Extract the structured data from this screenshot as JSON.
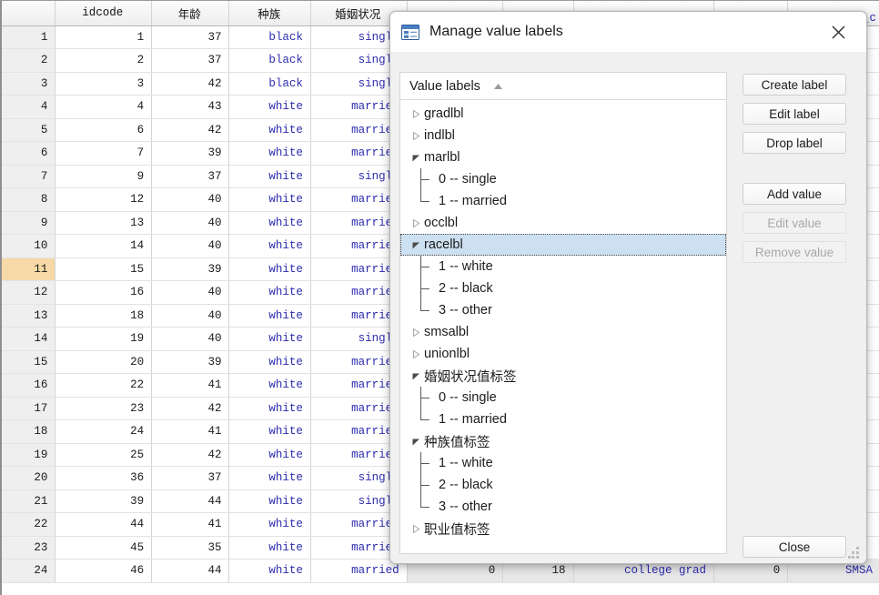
{
  "grid": {
    "columns": [
      {
        "key": "rownum",
        "label": "",
        "cjk": false
      },
      {
        "key": "idcode",
        "label": "idcode",
        "cjk": false
      },
      {
        "key": "age",
        "label": "年龄",
        "cjk": true
      },
      {
        "key": "race",
        "label": "种族",
        "cjk": true
      },
      {
        "key": "marital",
        "label": "婚姻状况",
        "cjk": true
      }
    ],
    "partial_header_right": "c_c",
    "selected_row": 11,
    "rows": [
      {
        "n": "1",
        "idcode": "1",
        "age": "37",
        "race": "black",
        "marital": "single"
      },
      {
        "n": "2",
        "idcode": "2",
        "age": "37",
        "race": "black",
        "marital": "single"
      },
      {
        "n": "3",
        "idcode": "3",
        "age": "42",
        "race": "black",
        "marital": "single"
      },
      {
        "n": "4",
        "idcode": "4",
        "age": "43",
        "race": "white",
        "marital": "married"
      },
      {
        "n": "5",
        "idcode": "6",
        "age": "42",
        "race": "white",
        "marital": "married"
      },
      {
        "n": "6",
        "idcode": "7",
        "age": "39",
        "race": "white",
        "marital": "married"
      },
      {
        "n": "7",
        "idcode": "9",
        "age": "37",
        "race": "white",
        "marital": "single"
      },
      {
        "n": "8",
        "idcode": "12",
        "age": "40",
        "race": "white",
        "marital": "married"
      },
      {
        "n": "9",
        "idcode": "13",
        "age": "40",
        "race": "white",
        "marital": "married"
      },
      {
        "n": "10",
        "idcode": "14",
        "age": "40",
        "race": "white",
        "marital": "married"
      },
      {
        "n": "11",
        "idcode": "15",
        "age": "39",
        "race": "white",
        "marital": "married"
      },
      {
        "n": "12",
        "idcode": "16",
        "age": "40",
        "race": "white",
        "marital": "married"
      },
      {
        "n": "13",
        "idcode": "18",
        "age": "40",
        "race": "white",
        "marital": "married"
      },
      {
        "n": "14",
        "idcode": "19",
        "age": "40",
        "race": "white",
        "marital": "single"
      },
      {
        "n": "15",
        "idcode": "20",
        "age": "39",
        "race": "white",
        "marital": "married"
      },
      {
        "n": "16",
        "idcode": "22",
        "age": "41",
        "race": "white",
        "marital": "married"
      },
      {
        "n": "17",
        "idcode": "23",
        "age": "42",
        "race": "white",
        "marital": "married"
      },
      {
        "n": "18",
        "idcode": "24",
        "age": "41",
        "race": "white",
        "marital": "married"
      },
      {
        "n": "19",
        "idcode": "25",
        "age": "42",
        "race": "white",
        "marital": "married"
      },
      {
        "n": "20",
        "idcode": "36",
        "age": "37",
        "race": "white",
        "marital": "single"
      },
      {
        "n": "21",
        "idcode": "39",
        "age": "44",
        "race": "white",
        "marital": "single"
      },
      {
        "n": "22",
        "idcode": "44",
        "age": "41",
        "race": "white",
        "marital": "married"
      },
      {
        "n": "23",
        "idcode": "45",
        "age": "35",
        "race": "white",
        "marital": "married"
      },
      {
        "n": "24",
        "idcode": "46",
        "age": "44",
        "race": "white",
        "marital": "married",
        "extra": [
          "0",
          "18",
          "college grad",
          "0",
          "SMSA"
        ]
      }
    ]
  },
  "dialog": {
    "title": "Manage value labels",
    "icon": "value-labels-icon",
    "close_icon": "close-icon",
    "tree_header": "Value labels",
    "sort_direction": "ascending",
    "selection_color": "#cde0f1",
    "nodes": [
      {
        "label": "gradlbl",
        "expanded": false,
        "cjk": false,
        "selected": false,
        "children": []
      },
      {
        "label": "indlbl",
        "expanded": false,
        "cjk": false,
        "selected": false,
        "children": []
      },
      {
        "label": "marlbl",
        "expanded": true,
        "cjk": false,
        "selected": false,
        "children": [
          "0 -- single",
          "1 -- married"
        ]
      },
      {
        "label": "occlbl",
        "expanded": false,
        "cjk": false,
        "selected": false,
        "children": []
      },
      {
        "label": "racelbl",
        "expanded": true,
        "cjk": false,
        "selected": true,
        "children": [
          "1 -- white",
          "2 -- black",
          "3 -- other"
        ]
      },
      {
        "label": "smsalbl",
        "expanded": false,
        "cjk": false,
        "selected": false,
        "children": []
      },
      {
        "label": "unionlbl",
        "expanded": false,
        "cjk": false,
        "selected": false,
        "children": []
      },
      {
        "label": "婚姻状况值标签",
        "expanded": true,
        "cjk": true,
        "selected": false,
        "children": [
          "0 -- single",
          "1 -- married"
        ]
      },
      {
        "label": "种族值标签",
        "expanded": true,
        "cjk": true,
        "selected": false,
        "children": [
          "1 -- white",
          "2 -- black",
          "3 -- other"
        ]
      },
      {
        "label": "职业值标签",
        "expanded": false,
        "cjk": true,
        "selected": false,
        "children": []
      }
    ],
    "buttons": {
      "create_label": "Create label",
      "edit_label": "Edit label",
      "drop_label": "Drop label",
      "add_value": "Add value",
      "edit_value": "Edit value",
      "remove_value": "Remove value",
      "close": "Close"
    },
    "disabled_buttons": [
      "edit_value",
      "remove_value"
    ],
    "resize_grip": "resize-grip-icon"
  }
}
